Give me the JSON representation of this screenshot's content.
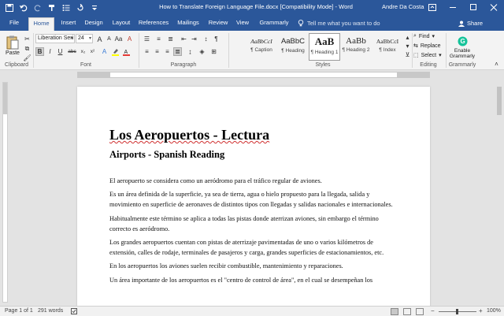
{
  "window": {
    "title": "How to Translate Foreign Language File.docx [Compatibility Mode] - Word",
    "user": "Andre Da Costa"
  },
  "tabs": [
    {
      "label": "File"
    },
    {
      "label": "Home"
    },
    {
      "label": "Insert"
    },
    {
      "label": "Design"
    },
    {
      "label": "Layout"
    },
    {
      "label": "References"
    },
    {
      "label": "Mailings"
    },
    {
      "label": "Review"
    },
    {
      "label": "View"
    },
    {
      "label": "Grammarly"
    }
  ],
  "tell_me": "Tell me what you want to do",
  "share": "Share",
  "ribbon": {
    "clipboard": {
      "paste": "Paste",
      "label": "Clipboard"
    },
    "font": {
      "name": "Liberation Seri",
      "size": "24",
      "label": "Font"
    },
    "paragraph": {
      "label": "Paragraph"
    },
    "styles": {
      "label": "Styles",
      "items": [
        {
          "sample": "AaBbCcI",
          "name": "¶ Caption"
        },
        {
          "sample": "AaBbC",
          "name": "¶ Heading"
        },
        {
          "sample": "AaB",
          "name": "¶ Heading 1"
        },
        {
          "sample": "AaBb",
          "name": "¶ Heading 2"
        },
        {
          "sample": "AaBbCcI",
          "name": "¶ Index"
        }
      ]
    },
    "editing": {
      "find": "Find",
      "replace": "Replace",
      "select": "Select",
      "label": "Editing"
    },
    "grammarly": {
      "line1": "Enable",
      "line2": "Grammarly",
      "label": "Grammarly"
    }
  },
  "document": {
    "title": "Los Aeropuertos - Lectura",
    "subtitle": "Airports - Spanish Reading",
    "paragraphs": [
      "El aeropuerto se considera como un aeródromo para el tráfico regular de aviones.",
      "Es un área definida de la superficie, ya sea de tierra, agua o hielo propuesto para la llegada, salida y movimiento en superficie de aeronaves de distintos tipos con llegadas y salidas nacionales e internacionales.",
      "Habitualmente este término se aplica a todas las pistas donde aterrizan aviones, sin embargo el término correcto es aeródromo.",
      "Los grandes aeropuertos cuentan con pistas de aterrizaje pavimentadas de uno o varios kilómetros de extensión, calles de rodaje, terminales de pasajeros y carga, grandes superficies de estacionamientos, etc.",
      "En los aeropuertos los aviones suelen recibir combustible, mantenimiento y reparaciones.",
      "Un área importante de los aeropuertos es el \"centro de control de área\", en el cual se desempeñan los"
    ]
  },
  "status": {
    "page": "Page 1 of 1",
    "words": "291 words",
    "zoom": "100%"
  },
  "colors": {
    "accent": "#2b579a",
    "ribbon_bg": "#f3f3f3",
    "canvas_bg": "#e3e3e3",
    "spell_underline": "#d03030"
  }
}
